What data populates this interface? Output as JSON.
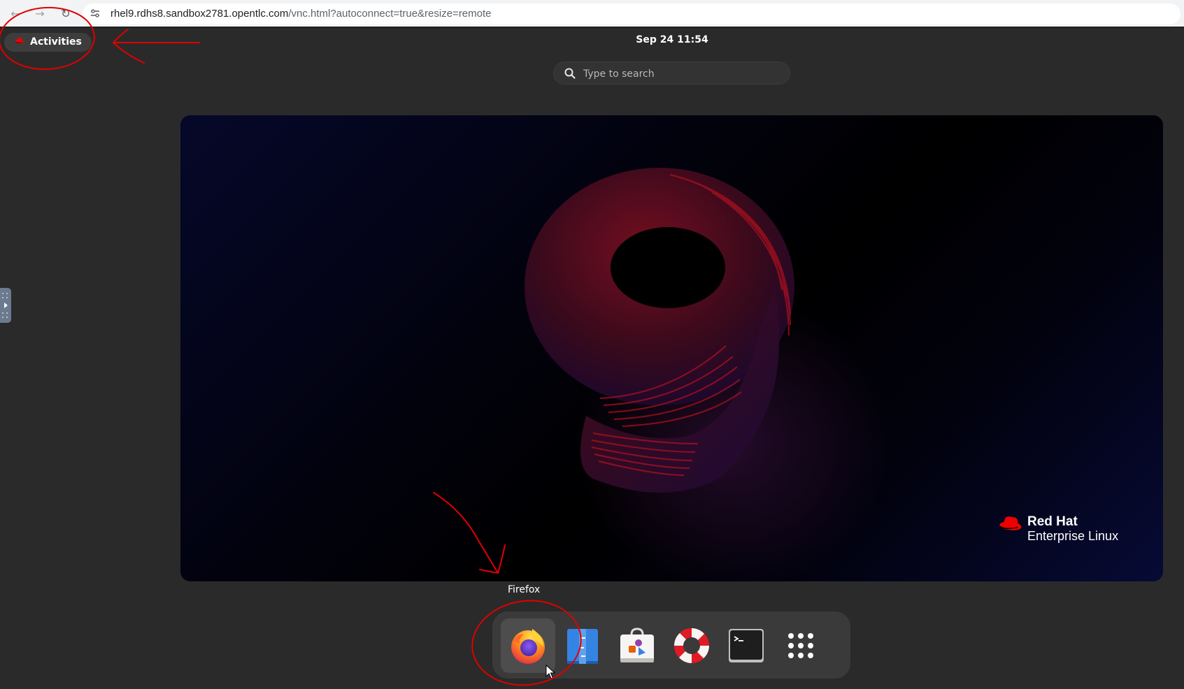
{
  "browser": {
    "url_host": "rhel9.rdhs8.sandbox2781.opentlc.com",
    "url_path": "/vnc.html?autoconnect=true&resize=remote",
    "back_icon": "arrow-left-icon",
    "forward_icon": "arrow-right-icon",
    "reload_icon": "reload-icon",
    "site_info_icon": "site-settings-icon"
  },
  "top_panel": {
    "activities_label": "Activities",
    "clock": "Sep 24  11:54"
  },
  "search": {
    "placeholder": "Type to search"
  },
  "wallpaper": {
    "brand_line1": "Red Hat",
    "brand_line2": "Enterprise Linux"
  },
  "dash": {
    "tooltip": "Firefox",
    "items": [
      {
        "name": "Firefox",
        "icon": "firefox-icon"
      },
      {
        "name": "Files",
        "icon": "files-icon"
      },
      {
        "name": "Software",
        "icon": "software-icon"
      },
      {
        "name": "Help",
        "icon": "help-lifebuoy-icon"
      },
      {
        "name": "Terminal",
        "icon": "terminal-icon"
      },
      {
        "name": "Show Apps",
        "icon": "app-grid-icon"
      }
    ]
  },
  "colors": {
    "panel_bg": "#2a2a2a",
    "annotation_red": "#e00000",
    "redhat_red": "#ee0000"
  }
}
